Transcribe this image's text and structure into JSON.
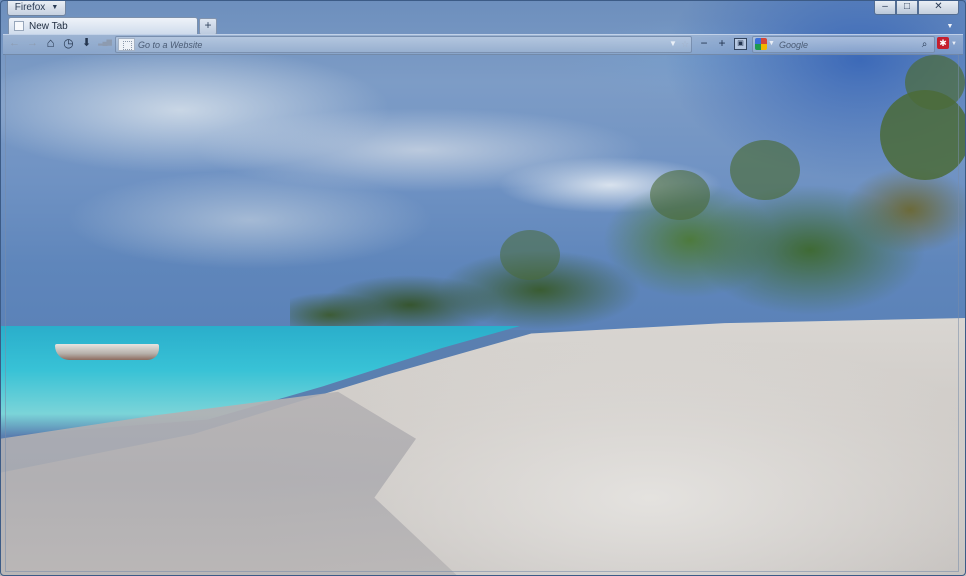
{
  "window": {
    "app_menu_label": "Firefox",
    "caption": {
      "minimize": "–",
      "maximize": "□",
      "close": "✕"
    }
  },
  "tabs": [
    {
      "label": "New Tab",
      "favicon": "blank-page-icon",
      "selected": true
    }
  ],
  "tabstrip": {
    "new_tab_symbol": "+",
    "list_tabs_symbol": "▼"
  },
  "toolbar": {
    "back_icon": "←",
    "forward_icon": "→",
    "home_icon": "⌂",
    "history_icon": "◷",
    "downloads_icon": "⬇",
    "signal_icon": "▂▄▆",
    "urlbar": {
      "placeholder": "Go to a Website",
      "value": "",
      "dropmarker": "▼",
      "star": "☆"
    },
    "zoom_out": "−",
    "zoom_in": "+",
    "zoom_reset": "▣",
    "search": {
      "engine": "Google",
      "engine_caret": "▼",
      "placeholder": "Google",
      "value": "",
      "go_icon": "⌕"
    },
    "addon_button": "✱",
    "addon_caret": "▼"
  },
  "colors": {
    "chrome_border": "#3c5b86",
    "addon_red": "#c41f2e"
  }
}
